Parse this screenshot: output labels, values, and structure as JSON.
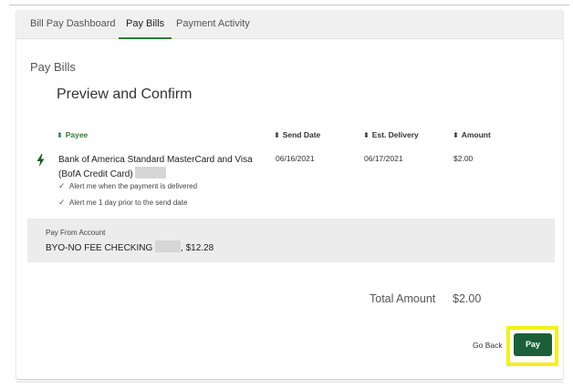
{
  "tabs": [
    "Bill Pay Dashboard",
    "Pay Bills",
    "Payment Activity"
  ],
  "active_tab": "Pay Bills",
  "section_title": "Pay Bills",
  "page_heading": "Preview and Confirm",
  "columns": {
    "payee": "Payee",
    "send_date": "Send Date",
    "est_delivery": "Est. Delivery",
    "amount": "Amount"
  },
  "payment": {
    "payee_line1": "Bank of America Standard MasterCard and Visa",
    "payee_line2": "(BofA Credit Card)",
    "send_date": "06/16/2021",
    "est_delivery": "06/17/2021",
    "amount": "$2.00",
    "alerts": [
      "Alert me when the payment is delivered",
      "Alert me 1 day prior to the send date"
    ]
  },
  "pay_from": {
    "label": "Pay From Account",
    "account_name": "BYO-NO FEE CHECKING",
    "balance": ", $12.28"
  },
  "total": {
    "label": "Total Amount",
    "value": "$2.00"
  },
  "actions": {
    "go_back": "Go Back",
    "pay": "Pay"
  },
  "colors": {
    "accent_green": "#2e7d32",
    "pay_button": "#1b5e38",
    "highlight": "#f5f01a"
  }
}
